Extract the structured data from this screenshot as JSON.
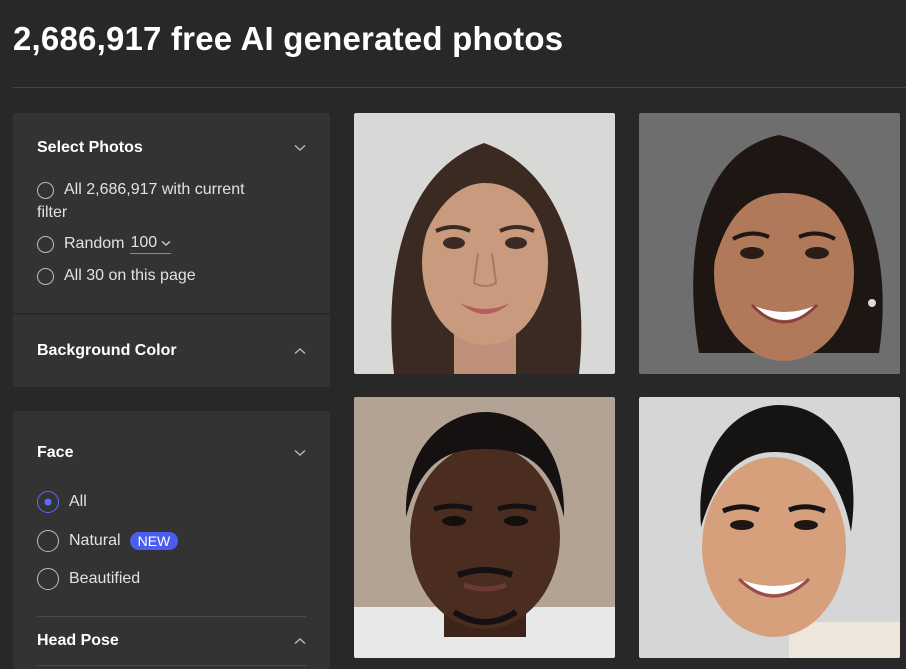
{
  "page": {
    "title": "2,686,917 free AI generated photos"
  },
  "select_photos": {
    "title": "Select Photos",
    "option_all_line1": "All 2,686,917 with current",
    "option_all_line2": "filter",
    "option_random_label": "Random",
    "option_random_value": "100",
    "option_page": "All 30 on this page"
  },
  "background_color": {
    "title": "Background Color"
  },
  "face": {
    "title": "Face",
    "options": [
      "All",
      "Natural",
      "Beautified"
    ],
    "selected": "All",
    "new_badge": "NEW"
  },
  "head_pose": {
    "title": "Head Pose"
  },
  "photos": [
    {
      "name": "woman-long-dark-hair",
      "bg": "#d8d8d6",
      "skin": "#c99a7d",
      "hair": "#3a2a22"
    },
    {
      "name": "woman-smiling-updo",
      "bg": "#6e6e6e",
      "skin": "#b07a5a",
      "hair": "#1e1613"
    },
    {
      "name": "man-dark-skin-mustache",
      "bg": "#b3a394",
      "skin": "#4a2c20",
      "hair": "#151111"
    },
    {
      "name": "man-smiling-short-hair",
      "bg": "#d6d6d6",
      "skin": "#d6a07d",
      "hair": "#161313"
    }
  ]
}
